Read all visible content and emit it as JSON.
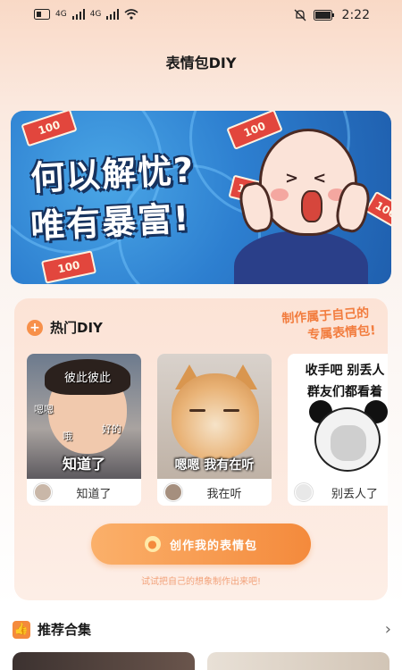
{
  "status_bar": {
    "left_icons": [
      "sim-card-icon",
      "signal-icon",
      "signal-icon",
      "wifi-icon"
    ],
    "sim_labels": [
      "4G",
      "4G"
    ],
    "time": "2:22"
  },
  "header": {
    "title": "表情包DIY"
  },
  "banner": {
    "line1": "何以解忧?",
    "line2": "唯有暴富!",
    "money_label": "100"
  },
  "hot_diy": {
    "title": "热门DIY",
    "slogan_line1": "制作属于自己的",
    "slogan_line2": "专属表情包!",
    "items": [
      {
        "image_caption": "知道了",
        "overlay_top": "彼此彼此",
        "overlay_left": "嗯嗯",
        "overlay_mid": "哦",
        "overlay_right": "好的",
        "name": "知道了"
      },
      {
        "image_caption": "嗯嗯  我有在听",
        "name": "我在听"
      },
      {
        "image_line1": "收手吧 别丢人",
        "image_line2": "群友们都看着",
        "name": "别丢人了"
      }
    ],
    "cta_label": "创作我的表情包",
    "hint": "试试把自己的想象制作出来吧!"
  },
  "recommend": {
    "title": "推荐合集"
  },
  "colors": {
    "accent": "#f48a3c",
    "banner_blue": "#2d7fd0",
    "card_bg": "#fce3d6"
  }
}
